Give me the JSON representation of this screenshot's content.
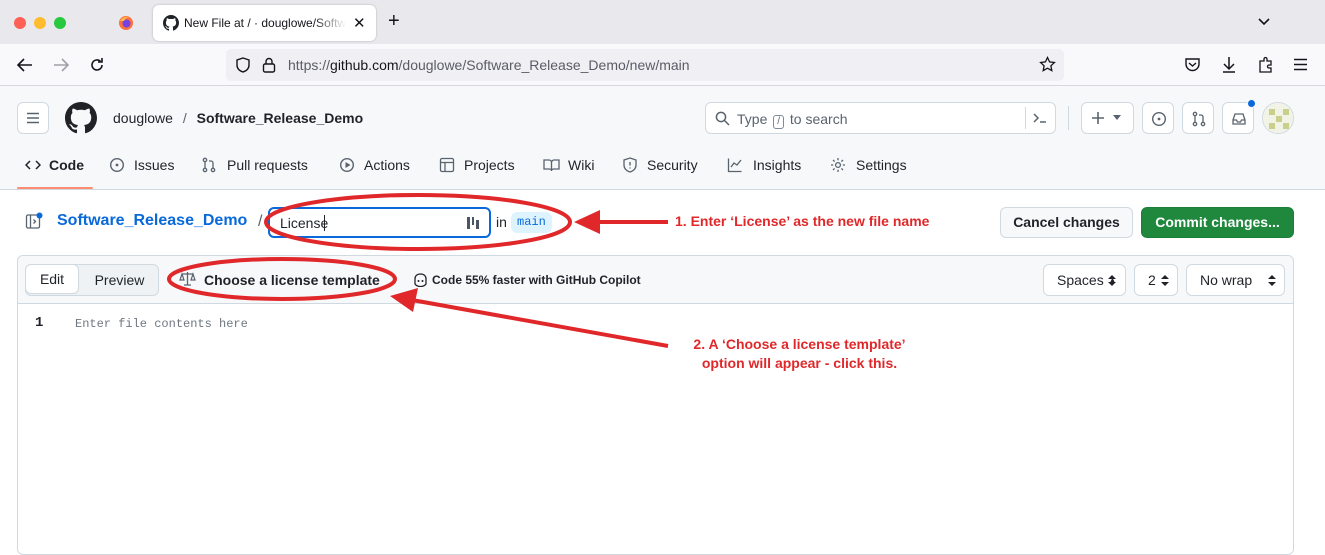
{
  "browser": {
    "tab_title": "New File at / · douglowe/Software_Release_Demo",
    "url_prefix": "https://",
    "url_host": "github.com",
    "url_path": "/douglowe/Software_Release_Demo/new/main",
    "new_tab": "+"
  },
  "header": {
    "owner": "douglowe",
    "separator": "/",
    "repo": "Software_Release_Demo",
    "search_prefix": "Type",
    "search_key": "/",
    "search_suffix": "to search"
  },
  "repo_nav": [
    {
      "label": "Code",
      "icon": "code-icon"
    },
    {
      "label": "Issues",
      "icon": "issue-icon"
    },
    {
      "label": "Pull requests",
      "icon": "pull-request-icon"
    },
    {
      "label": "Actions",
      "icon": "play-icon"
    },
    {
      "label": "Projects",
      "icon": "table-icon"
    },
    {
      "label": "Wiki",
      "icon": "book-icon"
    },
    {
      "label": "Security",
      "icon": "shield-icon"
    },
    {
      "label": "Insights",
      "icon": "graph-icon"
    },
    {
      "label": "Settings",
      "icon": "gear-icon"
    }
  ],
  "file": {
    "repo_link": "Software_Release_Demo",
    "path_sep": "/",
    "name_value": "License",
    "in_label": "in",
    "branch": "main",
    "cancel_label": "Cancel changes",
    "commit_label": "Commit changes..."
  },
  "editor": {
    "tab_edit": "Edit",
    "tab_preview": "Preview",
    "license_template": "Choose a license template",
    "copilot": "Code 55% faster with GitHub Copilot",
    "indent_mode": "Spaces",
    "indent_size": "2",
    "wrap_mode": "No wrap",
    "line_number": "1",
    "placeholder": "Enter file contents here"
  },
  "annotations": {
    "step1": "1. Enter ‘License’ as the new file name",
    "step2_line1": "2. A ‘Choose a license template’",
    "step2_line2": "option will appear - click this.",
    "color": "#e0282b"
  },
  "colors": {
    "link": "#0969da",
    "commit_green": "#1f883d",
    "nav_underline": "#fd8c73"
  }
}
